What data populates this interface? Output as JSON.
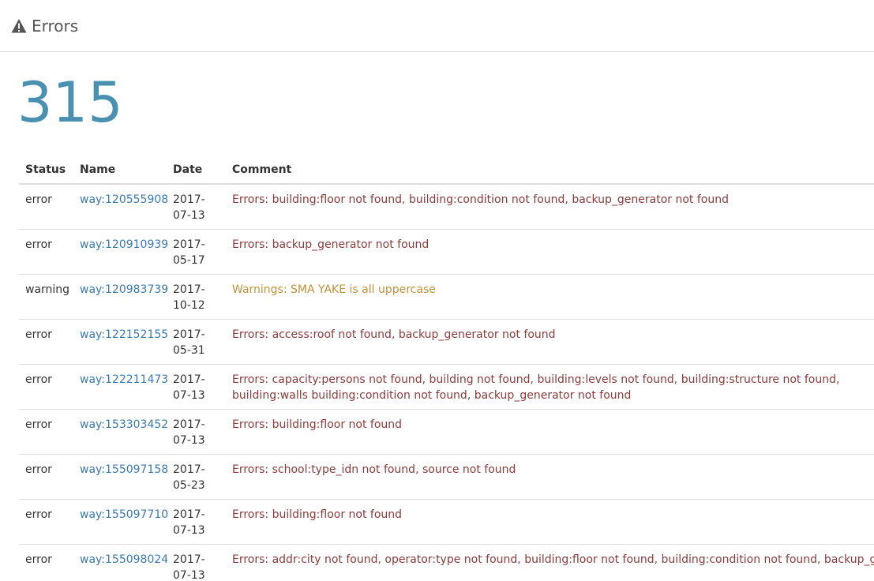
{
  "header": {
    "title": "Errors",
    "icon": "warning-triangle-icon"
  },
  "count": "315",
  "table": {
    "columns": [
      "Status",
      "Name",
      "Date",
      "Comment"
    ],
    "rows": [
      {
        "status": "error",
        "name": "way:120555908",
        "date": "2017-07-13",
        "comment": "Errors: building:floor not found, building:condition not found, backup_generator not found",
        "type": "error"
      },
      {
        "status": "error",
        "name": "way:120910939",
        "date": "2017-05-17",
        "comment": "Errors: backup_generator not found",
        "type": "error"
      },
      {
        "status": "warning",
        "name": "way:120983739",
        "date": "2017-10-12",
        "comment": "Warnings: SMA YAKE is all uppercase",
        "type": "warning"
      },
      {
        "status": "error",
        "name": "way:122152155",
        "date": "2017-05-31",
        "comment": "Errors: access:roof not found, backup_generator not found",
        "type": "error"
      },
      {
        "status": "error",
        "name": "way:122211473",
        "date": "2017-07-13",
        "comment": "Errors: capacity:persons not found, building not found, building:levels not found, building:structure not found, building:walls building:condition not found, backup_generator not found",
        "type": "error"
      },
      {
        "status": "error",
        "name": "way:153303452",
        "date": "2017-07-13",
        "comment": "Errors: building:floor not found",
        "type": "error"
      },
      {
        "status": "error",
        "name": "way:155097158",
        "date": "2017-05-23",
        "comment": "Errors: school:type_idn not found, source not found",
        "type": "error"
      },
      {
        "status": "error",
        "name": "way:155097710",
        "date": "2017-07-13",
        "comment": "Errors: building:floor not found",
        "type": "error"
      },
      {
        "status": "error",
        "name": "way:155098024",
        "date": "2017-07-13",
        "comment": "Errors: addr:city not found, operator:type not found, building:floor not found, building:condition not found, backup_generator not found",
        "type": "error"
      }
    ]
  }
}
